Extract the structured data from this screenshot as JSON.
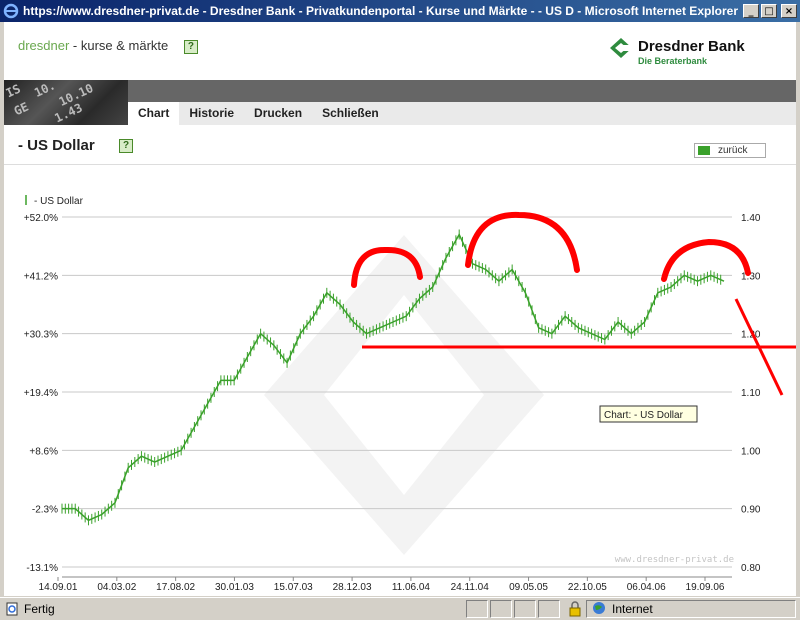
{
  "window": {
    "title": "https://www.dresdner-privat.de - Dresdner Bank - Privatkundenportal - Kurse und Märkte - - US D - Microsoft Internet Explorer"
  },
  "brand": {
    "name": "dresdner",
    "sub": " - kurse & märkte",
    "help": "?",
    "logo_name": "Dresdner Bank",
    "logo_tag": "Die Beraterbank"
  },
  "tabs": [
    "Chart",
    "Historie",
    "Drucken",
    "Schließen"
  ],
  "page": {
    "title": "- US Dollar",
    "help": "?",
    "back": "zurück"
  },
  "status": {
    "text": "Fertig",
    "zone": "Internet"
  },
  "colors": {
    "series": "#3aa12b",
    "annotation": "#ff0000",
    "logo": "#2e8b3e"
  },
  "chart_data": {
    "type": "line",
    "legend": "- US Dollar",
    "tooltip": "Chart:   - US Dollar",
    "watermark": "www.dresdner-privat.de",
    "x": [
      "14.09.01",
      "04.03.02",
      "17.08.02",
      "30.01.03",
      "15.07.03",
      "28.12.03",
      "11.06.04",
      "24.11.04",
      "09.05.05",
      "22.10.05",
      "06.04.06",
      "19.09.06"
    ],
    "left_ticks": [
      "+52.0%",
      "+41.2%",
      "+30.3%",
      "+19.4%",
      "+8.6%",
      "-2.3%",
      "-13.1%"
    ],
    "right_ticks": [
      "1.40",
      "1.30",
      "1.20",
      "1.10",
      "1.00",
      "0.90",
      "0.80"
    ],
    "ylim": [
      0.8,
      1.4
    ],
    "grid": true,
    "series": [
      {
        "values": [
          0.9,
          0.9,
          0.88,
          0.89,
          0.91,
          0.97,
          0.99,
          0.98,
          0.99,
          1.0,
          1.04,
          1.08,
          1.12,
          1.12,
          1.16,
          1.2,
          1.18,
          1.15,
          1.2,
          1.23,
          1.27,
          1.25,
          1.22,
          1.2,
          1.21,
          1.22,
          1.23,
          1.26,
          1.28,
          1.33,
          1.37,
          1.32,
          1.31,
          1.29,
          1.31,
          1.27,
          1.21,
          1.2,
          1.23,
          1.21,
          1.2,
          1.19,
          1.22,
          1.2,
          1.22,
          1.27,
          1.28,
          1.3,
          1.29,
          1.3,
          1.29
        ]
      }
    ]
  }
}
